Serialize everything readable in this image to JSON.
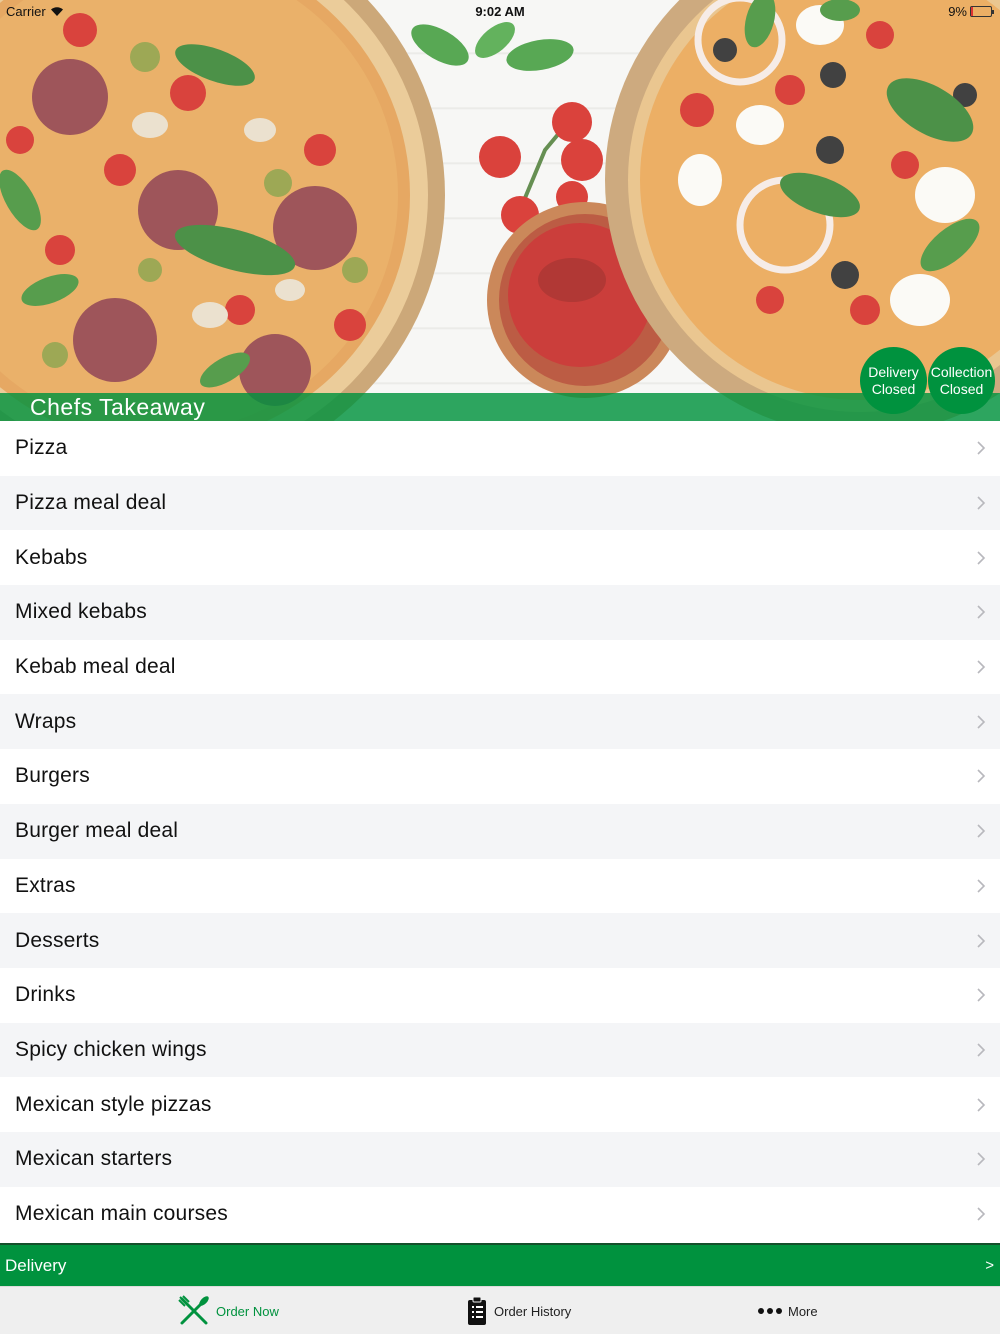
{
  "status_bar": {
    "carrier": "Carrier",
    "time": "9:02 AM",
    "battery": "9%",
    "battery_level": 0.09
  },
  "hero": {
    "restaurant_name": "Chefs Takeaway",
    "delivery_status": {
      "line1": "Delivery",
      "line2": "Closed"
    },
    "collection_status": {
      "line1": "Collection",
      "line2": "Closed"
    }
  },
  "menu": {
    "categories": [
      "Pizza",
      "Pizza meal deal",
      "Kebabs",
      "Mixed kebabs",
      "Kebab meal deal",
      "Wraps",
      "Burgers",
      "Burger meal deal",
      "Extras",
      "Desserts",
      "Drinks",
      "Spicy chicken wings",
      "Mexican style pizzas",
      "Mexican starters",
      "Mexican main courses"
    ]
  },
  "delivery_bar": {
    "label": "Delivery",
    "arrow": ">"
  },
  "tab_bar": {
    "order_now": "Order Now",
    "order_history": "Order History",
    "more": "More"
  },
  "colors": {
    "brand_green": "#00923e",
    "row_alt": "#f4f5f7",
    "tab_bar_bg": "#efefef"
  },
  "icons": {
    "order_now": "fork-knife-icon",
    "order_history": "clipboard-list-icon",
    "more": "more-dots-icon",
    "row_chevron": "chevron-right-icon"
  }
}
